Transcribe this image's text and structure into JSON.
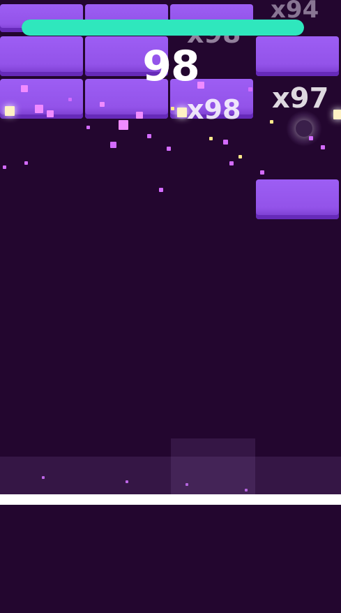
{
  "hud": {
    "progress_percent": 100,
    "score": "98",
    "progress_color": "#2fe7bd"
  },
  "multipliers": {
    "top_right": "x94",
    "top_center": "x98",
    "center": "x98",
    "right": "x97"
  },
  "colors": {
    "background": "#23062f",
    "brick": "#9a58f4",
    "particle": "#d36bff",
    "paddle": "#ffffff"
  }
}
